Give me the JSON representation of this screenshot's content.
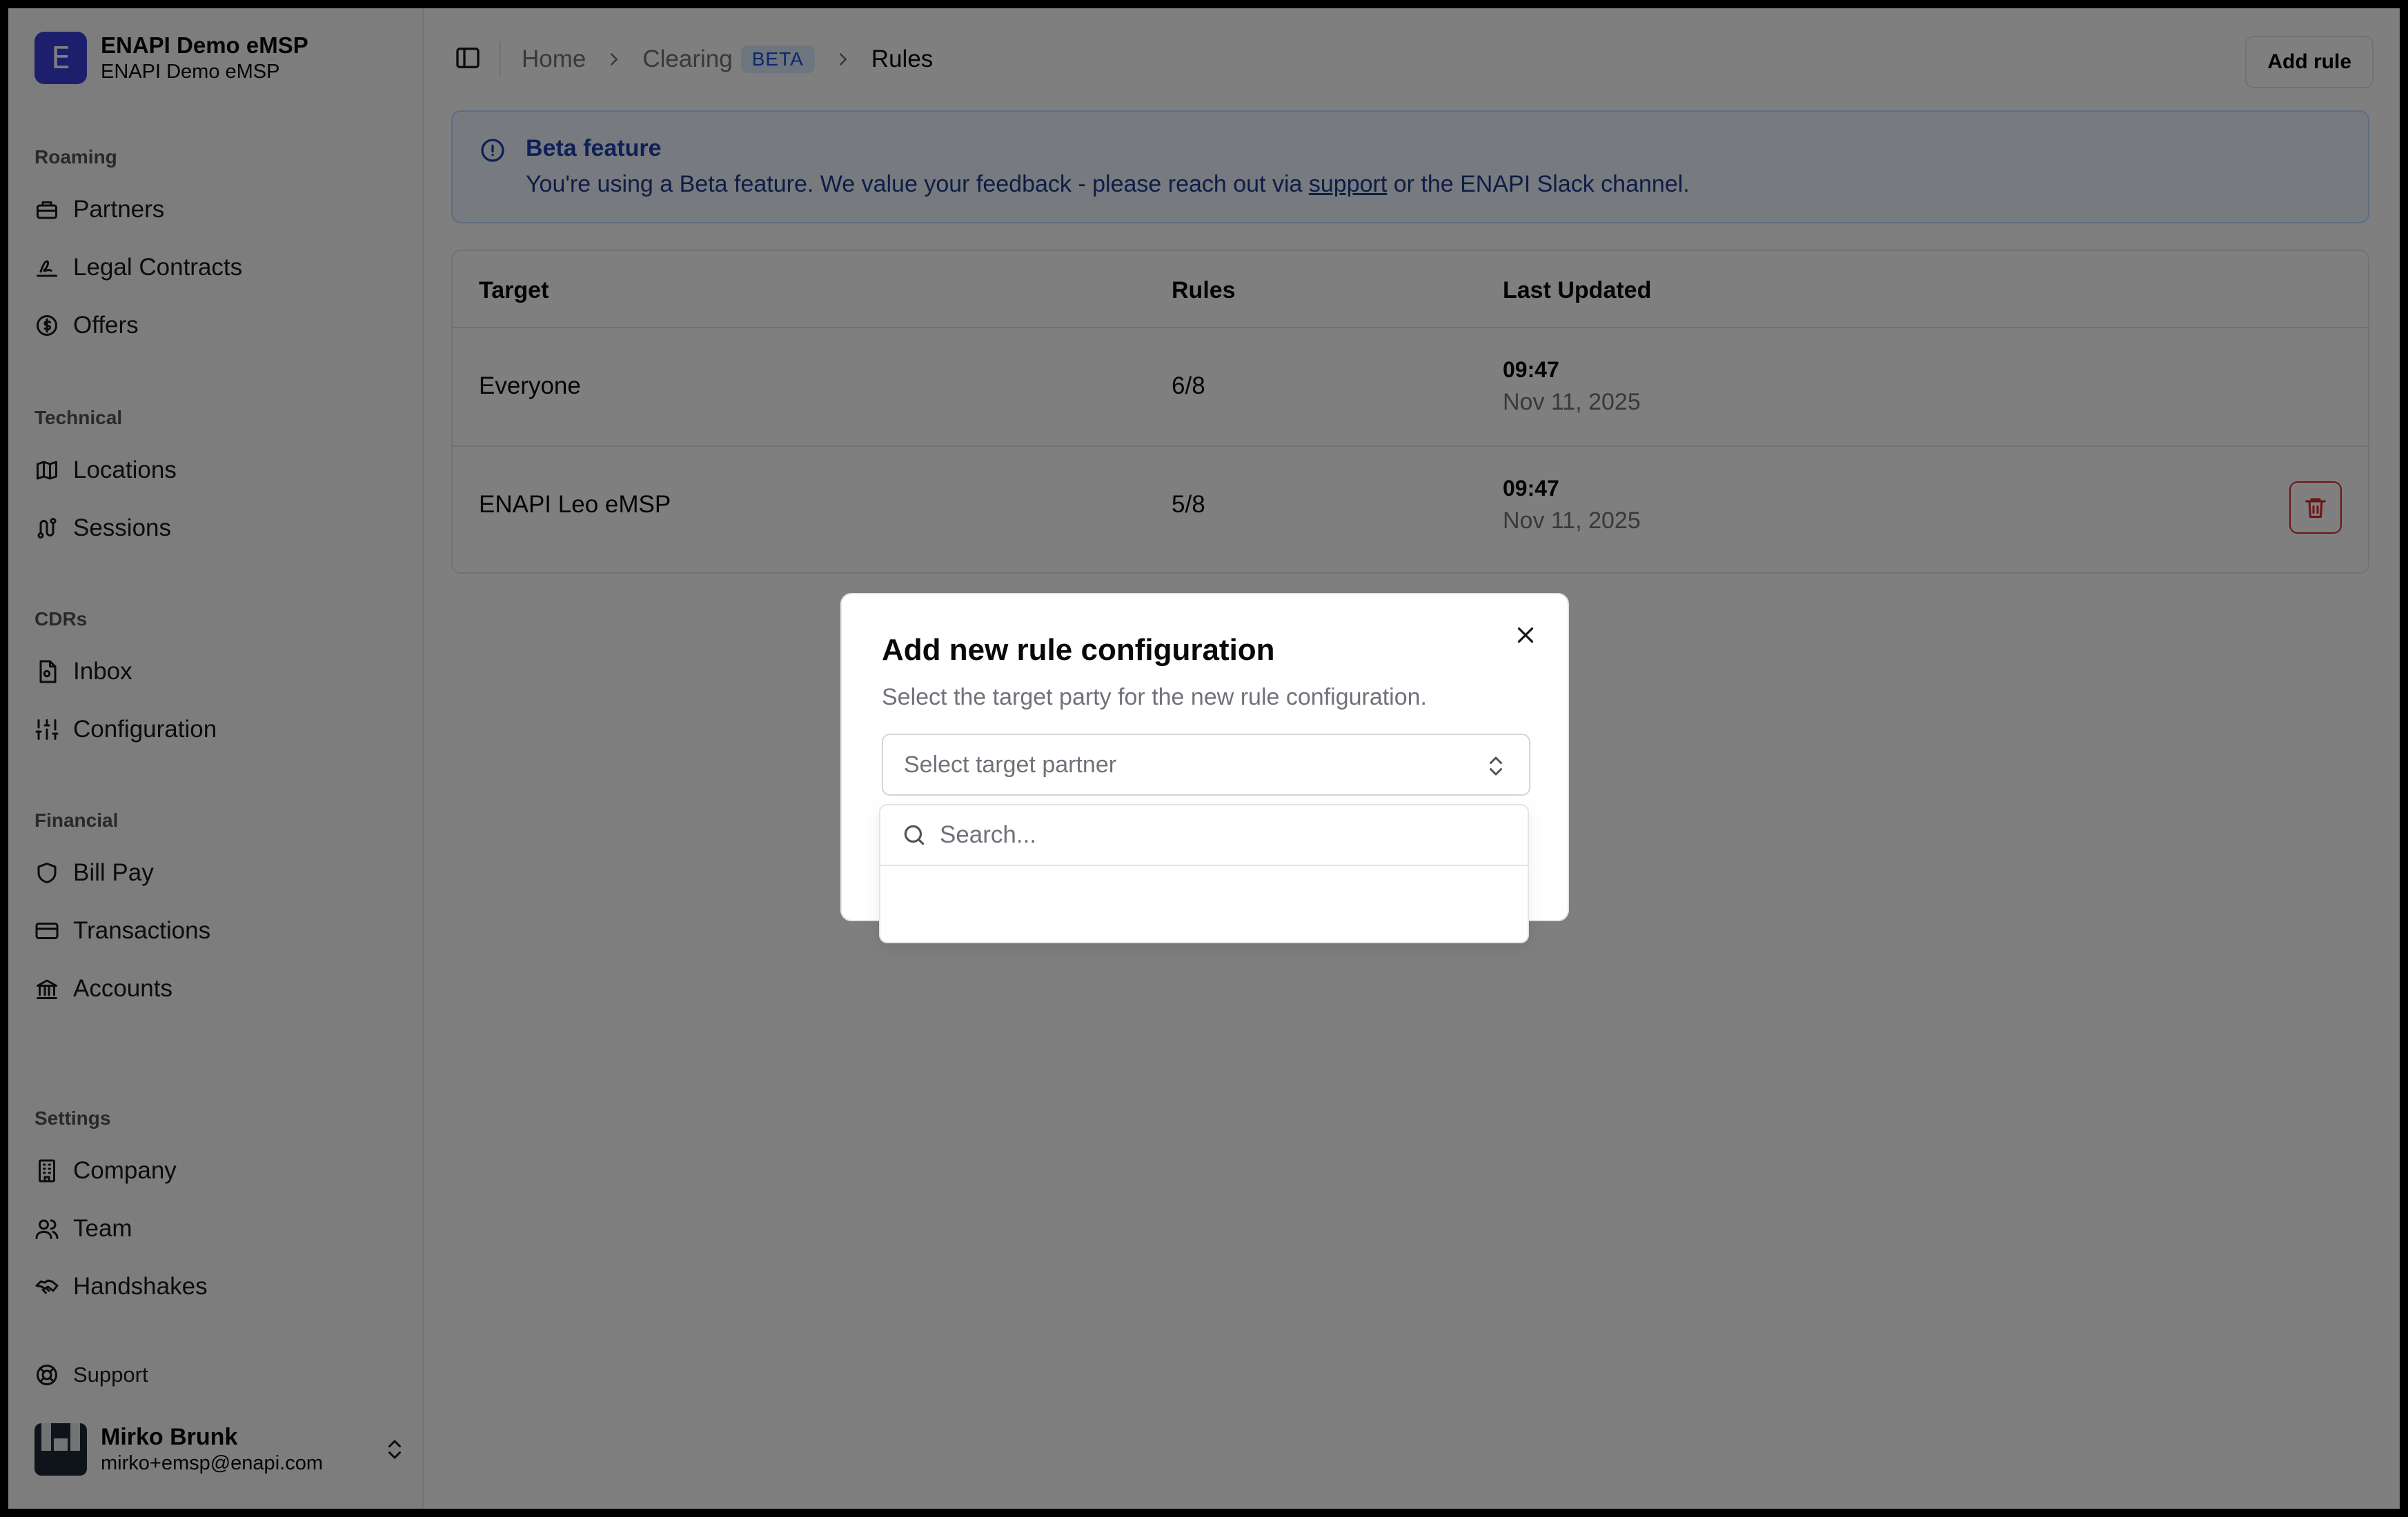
{
  "org": {
    "logo_letter": "E",
    "name": "ENAPI Demo eMSP",
    "subtitle": "ENAPI Demo eMSP",
    "brand_color": "#3b3fd8"
  },
  "sidebar": {
    "groups": [
      {
        "label": "Roaming",
        "items": [
          {
            "label": "Partners",
            "icon": "partners-icon"
          },
          {
            "label": "Legal Contracts",
            "icon": "signature-icon"
          },
          {
            "label": "Offers",
            "icon": "dollar-circle-icon"
          }
        ]
      },
      {
        "label": "Technical",
        "items": [
          {
            "label": "Locations",
            "icon": "map-icon"
          },
          {
            "label": "Sessions",
            "icon": "route-icon"
          }
        ]
      },
      {
        "label": "CDRs",
        "items": [
          {
            "label": "Inbox",
            "icon": "file-icon"
          },
          {
            "label": "Configuration",
            "icon": "sliders-icon"
          }
        ]
      },
      {
        "label": "Financial",
        "items": [
          {
            "label": "Bill Pay",
            "icon": "shield-icon"
          },
          {
            "label": "Transactions",
            "icon": "credit-card-icon"
          },
          {
            "label": "Accounts",
            "icon": "bank-icon"
          }
        ]
      },
      {
        "label": "Settings",
        "items": [
          {
            "label": "Company",
            "icon": "building-icon"
          },
          {
            "label": "Team",
            "icon": "users-icon"
          },
          {
            "label": "Handshakes",
            "icon": "handshake-icon"
          }
        ]
      }
    ],
    "support": "Support",
    "user": {
      "name": "Mirko Brunk",
      "email": "mirko+emsp@enapi.com"
    }
  },
  "breadcrumb": {
    "home": "Home",
    "clearing": "Clearing",
    "badge": "BETA",
    "current": "Rules"
  },
  "header": {
    "add_rule": "Add rule"
  },
  "alert": {
    "title": "Beta feature",
    "text_before": "You're using a Beta feature. We value your feedback - please reach out via ",
    "link": "support",
    "text_after": " or the ENAPI Slack channel."
  },
  "table": {
    "columns": [
      "Target",
      "Rules",
      "Last Updated"
    ],
    "rows": [
      {
        "target": "Everyone",
        "rules": "6/8",
        "time": "09:47",
        "date": "Nov 11, 2025"
      },
      {
        "target": "ENAPI Leo eMSP",
        "rules": "5/8",
        "time": "09:47",
        "date": "Nov 11, 2025"
      }
    ]
  },
  "modal": {
    "title": "Add new rule configuration",
    "description": "Select the target party for the new rule configuration.",
    "select_placeholder": "Select target partner",
    "search_placeholder": "Search..."
  }
}
